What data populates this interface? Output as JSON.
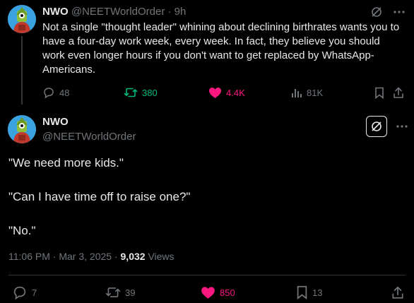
{
  "parent": {
    "name": "NWO",
    "handle": "@NEETWorldOrder",
    "separator": "·",
    "time": "9h",
    "text": "Not a single \"thought leader\" whining about declining birthrates wants you to have a four-day work week, every week. In fact, they believe you should work even longer hours if you don't want to get replaced by WhatsApp-Americans.",
    "stats": {
      "replies": "48",
      "reposts": "380",
      "likes": "4.4K",
      "views": "81K"
    },
    "icons": [
      "grok-icon",
      "more-icon",
      "reply-icon",
      "repost-icon",
      "like-icon",
      "views-icon",
      "bookmark-icon",
      "share-icon"
    ]
  },
  "main": {
    "name": "NWO",
    "handle": "@NEETWorldOrder",
    "lines": [
      "\"We need more kids.\"",
      "\"Can I have time off to raise one?\"",
      "\"No.\""
    ],
    "meta": {
      "time": "11:06 PM",
      "sep1": "·",
      "date": "Mar 3, 2025",
      "sep2": "·",
      "views_count": "9,032",
      "views_label": "Views"
    },
    "stats": {
      "replies": "7",
      "reposts": "39",
      "likes": "850",
      "bookmarks": "13"
    }
  },
  "colors": {
    "background": "#000000",
    "text": "#e7e9ea",
    "muted": "#71767b",
    "repost_active": "#00ba7c",
    "like_active": "#f91880",
    "avatar_bg": "#3aa3df"
  }
}
